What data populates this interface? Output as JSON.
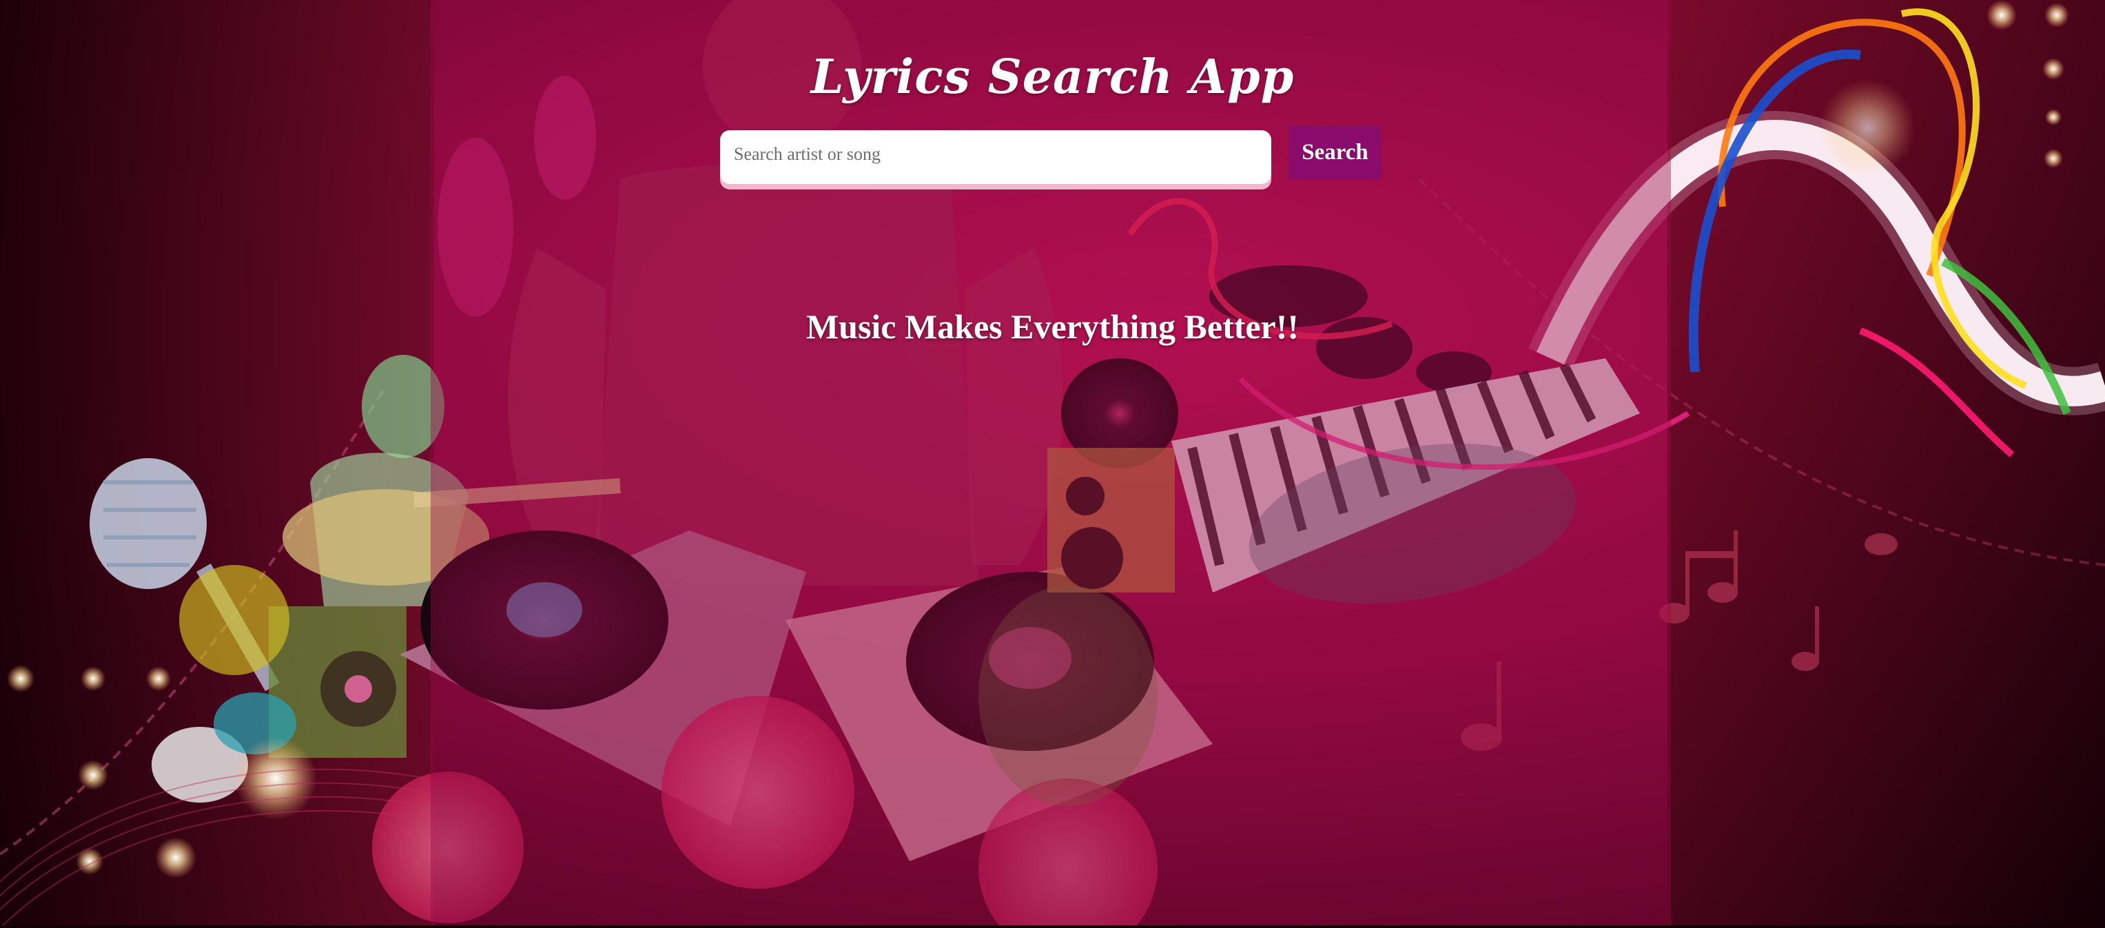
{
  "app": {
    "title": "Lyrics Search App"
  },
  "search": {
    "placeholder": "Search artist or song",
    "value": "",
    "button_label": "Search"
  },
  "hero": {
    "tagline": "Music Makes Everything Better!!"
  },
  "colors": {
    "button_bg": "#8a0b6c",
    "input_shadow": "#f2b7cc",
    "overlay": "#960a46",
    "text": "#ffffff"
  }
}
